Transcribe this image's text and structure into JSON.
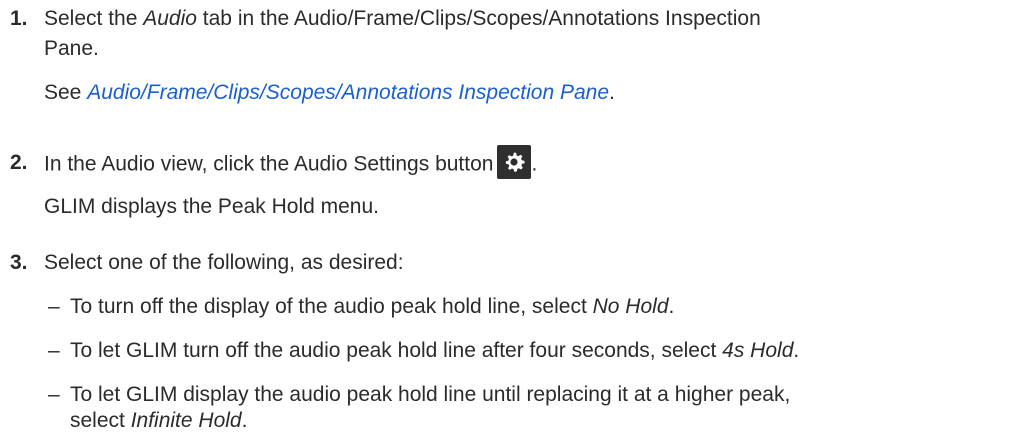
{
  "steps": [
    {
      "number": "1.",
      "text_pre": "Select the ",
      "text_em": "Audio",
      "text_post": " tab in the Audio/Frame/Clips/Scopes/Annotations Inspection",
      "text_cont": "Pane.",
      "see_prefix": "See ",
      "see_link": "Audio/Frame/Clips/Scopes/Annotations Inspection Pane",
      "see_suffix": "."
    },
    {
      "number": "2.",
      "text": "In the Audio view, click the Audio Settings button",
      "icon": "gear-icon",
      "text_after_icon": ".",
      "result": "GLIM displays the Peak Hold menu."
    },
    {
      "number": "3.",
      "text": "Select one of the following, as desired:",
      "options": [
        {
          "dash": "–",
          "text": "To turn off the display of the audio peak hold line, select ",
          "em": "No Hold",
          "suffix": "."
        },
        {
          "dash": "–",
          "text": "To let GLIM turn off the audio peak hold line after four seconds, select ",
          "em": "4s Hold",
          "suffix": "."
        },
        {
          "dash": "–",
          "text": "To let GLIM display the audio peak hold line until replacing it at a higher peak,",
          "text_cont": "select ",
          "em": "Infinite Hold",
          "suffix": "."
        }
      ]
    }
  ],
  "colors": {
    "text": "#2b2b2b",
    "link": "#1a5fd0",
    "icon_bg": "#2f2f2f"
  }
}
